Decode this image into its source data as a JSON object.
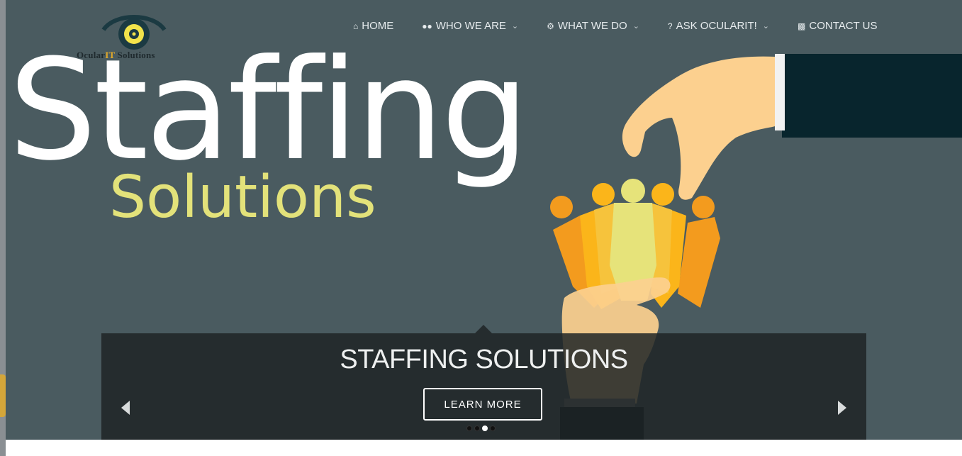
{
  "logo": {
    "text_pre": "Ocular",
    "text_hl": "IT",
    "text_post": " Solutions"
  },
  "nav": {
    "items": [
      {
        "label": "HOME",
        "icon": "home-icon",
        "dropdown": false
      },
      {
        "label": "WHO WE ARE",
        "icon": "users-icon",
        "dropdown": true
      },
      {
        "label": "WHAT WE DO",
        "icon": "gear-icon",
        "dropdown": true
      },
      {
        "label": "ASK OCULARIT!",
        "icon": "question-icon",
        "dropdown": true
      },
      {
        "label": "CONTACT US",
        "icon": "chat-icon",
        "dropdown": false
      }
    ]
  },
  "hero": {
    "title": "Staffing",
    "subtitle": "Solutions",
    "caption_title": "STAFFING SOLUTIONS",
    "button_label": "LEARN MORE",
    "active_slide": 3,
    "slide_count": 4
  },
  "colors": {
    "hero_bg": "#4a5b60",
    "accent_yellow": "#e3e27a",
    "caption_bg": "#1e2426"
  }
}
